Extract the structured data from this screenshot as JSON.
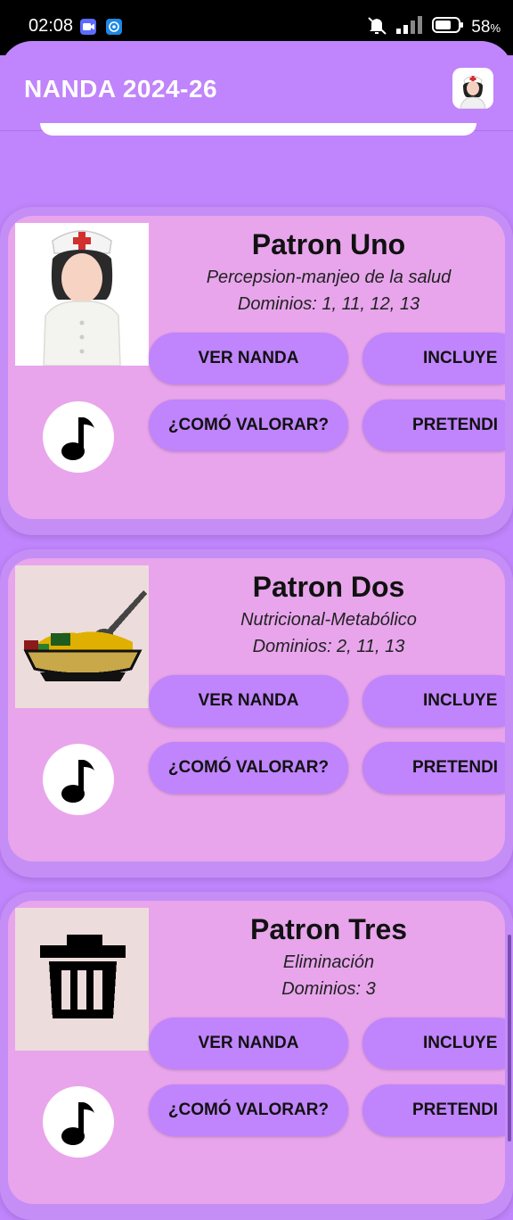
{
  "status": {
    "time": "02:08",
    "battery": "58",
    "battery_unit": "%"
  },
  "app": {
    "title": "NANDA 2024-26"
  },
  "buttons": {
    "ver_nanda": "VER NANDA",
    "incluye": "INCLUYE",
    "como_valorar": "¿COMÓ VALORAR?",
    "pretendi": "PRETENDI"
  },
  "patterns": [
    {
      "title": "Patron Uno",
      "subtitle": "Percepsion-manjeo de la salud",
      "domains": "Dominios: 1, 11, 12, 13",
      "image_icon": "nurse-icon"
    },
    {
      "title": "Patron Dos",
      "subtitle": "Nutricional-Metabólico",
      "domains": "Dominios: 2, 11, 13",
      "image_icon": "food-bowl-icon"
    },
    {
      "title": "Patron Tres",
      "subtitle": "Eliminación",
      "domains": "Dominios: 3",
      "image_icon": "trash-can-icon"
    }
  ],
  "colors": {
    "primary": "#c084fc",
    "card_bg": "#e8a5ec",
    "card_border": "#c58ef6"
  }
}
